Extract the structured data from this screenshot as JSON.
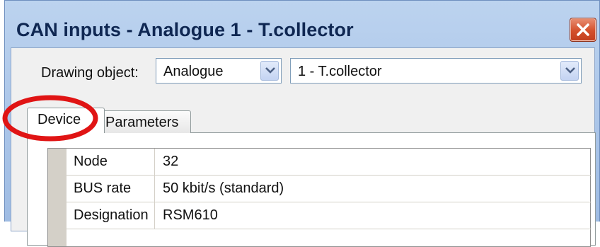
{
  "window": {
    "title": "CAN inputs - Analogue 1 - T.collector"
  },
  "drawing_object": {
    "label": "Drawing object:",
    "type_value": "Analogue",
    "object_value": "1 - T.collector"
  },
  "tabs": [
    {
      "label": "Device",
      "active": true
    },
    {
      "label": "Parameters",
      "active": false
    }
  ],
  "properties": [
    {
      "name": "Node",
      "value": "32"
    },
    {
      "name": "BUS rate",
      "value": "50 kbit/s (standard)"
    },
    {
      "name": "Designation",
      "value": "RSM610"
    }
  ],
  "colors": {
    "title_bar": "#a9c4e8",
    "close_button": "#d4502c",
    "annotation_ring": "#e01414"
  },
  "icons": [
    "close-icon",
    "chevron-down-icon"
  ]
}
